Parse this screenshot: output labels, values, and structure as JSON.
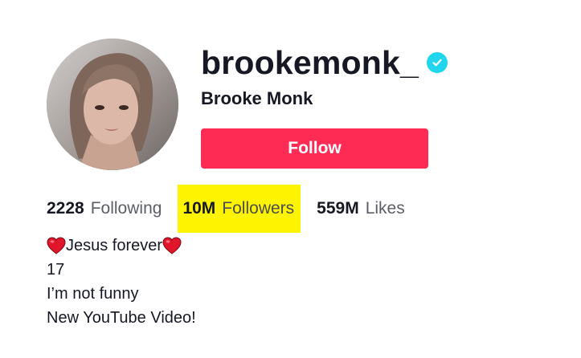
{
  "profile": {
    "username": "brookemonk_",
    "display_name": "Brooke Monk",
    "verified": true,
    "verified_icon": "verified-check-icon",
    "follow_label": "Follow",
    "avatar_icon": "profile-photo"
  },
  "stats": {
    "following_count": "2228",
    "following_label": "Following",
    "followers_count": "10M",
    "followers_label": "Followers",
    "likes_count": "559M",
    "likes_label": "Likes"
  },
  "bio": {
    "line1_text": "Jesus forever",
    "line1_icons": [
      "heart-icon",
      "heart-icon"
    ],
    "line2": "17",
    "line3": "I’m not funny",
    "line4": "New YouTube Video!"
  },
  "colors": {
    "follow_button": "#fe2c55",
    "verified_badge": "#20d5ec",
    "highlight": "#fef300",
    "heart": "#e0162b",
    "text_primary": "#161823",
    "text_secondary": "#5c5e66"
  }
}
